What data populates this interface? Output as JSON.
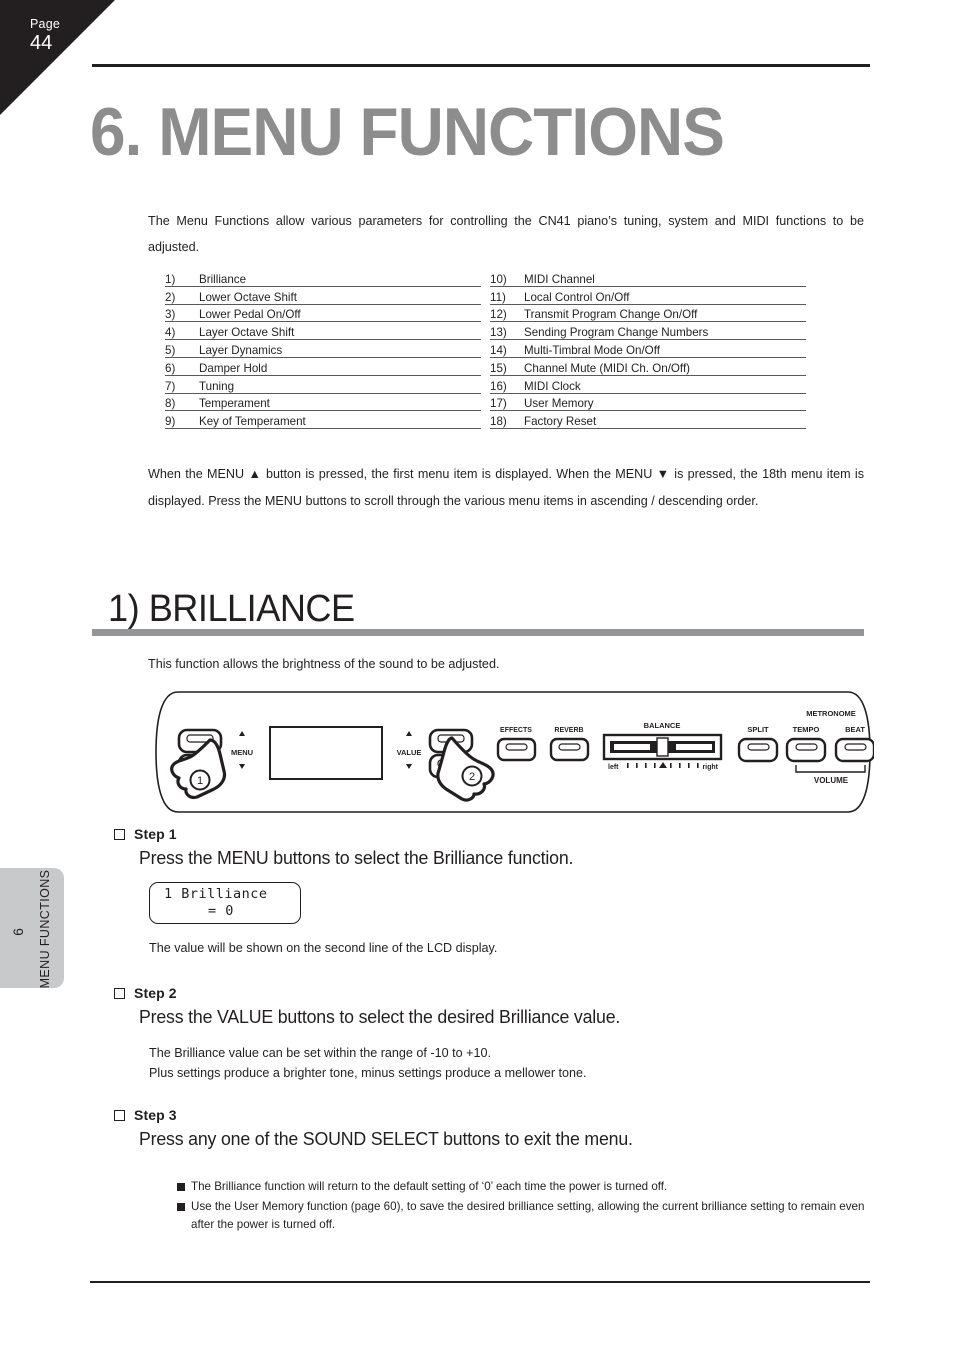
{
  "page": {
    "corner_label": "Page",
    "corner_number": "44",
    "chapter_title": "6. MENU FUNCTIONS",
    "intro": "The Menu Functions allow various parameters for controlling the CN41 piano’s tuning, system and MIDI functions to be adjusted.",
    "nav_paragraph": "When the MENU ▲ button is pressed, the first menu item is displayed.  When the MENU ▼ is pressed, the 18th menu item is displayed.  Press the MENU buttons to scroll through the various menu items in ascending / descending order."
  },
  "function_list": {
    "left": [
      {
        "num": "1)",
        "label": "Brilliance"
      },
      {
        "num": "2)",
        "label": "Lower Octave Shift"
      },
      {
        "num": "3)",
        "label": "Lower Pedal On/Off"
      },
      {
        "num": "4)",
        "label": "Layer Octave Shift"
      },
      {
        "num": "5)",
        "label": "Layer Dynamics"
      },
      {
        "num": "6)",
        "label": "Damper Hold"
      },
      {
        "num": "7)",
        "label": "Tuning"
      },
      {
        "num": "8)",
        "label": "Temperament"
      },
      {
        "num": "9)",
        "label": "Key of Temperament"
      }
    ],
    "right": [
      {
        "num": "10)",
        "label": "MIDI Channel"
      },
      {
        "num": "11)",
        "label": "Local Control On/Off"
      },
      {
        "num": "12)",
        "label": "Transmit Program Change On/Off"
      },
      {
        "num": "13)",
        "label": "Sending Program Change Numbers"
      },
      {
        "num": "14)",
        "label": "Multi-Timbral Mode On/Off"
      },
      {
        "num": "15)",
        "label": "Channel Mute (MIDI Ch. On/Off)"
      },
      {
        "num": "16)",
        "label": "MIDI Clock"
      },
      {
        "num": "17)",
        "label": "User Memory"
      },
      {
        "num": "18)",
        "label": "Factory Reset"
      }
    ]
  },
  "section": {
    "heading": "1) BRILLIANCE",
    "description": "This function allows the brightness of the sound to be adjusted."
  },
  "panel": {
    "menu_label": "MENU",
    "value_label": "VALUE",
    "effects_label": "EFFECTS",
    "reverb_label": "REVERB",
    "balance_label": "BALANCE",
    "balance_left": "left",
    "balance_right": "right",
    "split_label": "SPLIT",
    "metronome_label": "METRONOME",
    "tempo_label": "TEMPO",
    "beat_label": "BEAT",
    "volume_label": "VOLUME",
    "callout_1": "1",
    "callout_2": "2",
    "up_arrow": "▲",
    "down_arrow": "▼"
  },
  "steps": [
    {
      "title": "Step 1",
      "instruction": "Press the MENU buttons to select the Brilliance function.",
      "lcd_line1": "1 Brilliance",
      "lcd_line2": "=   0",
      "sub": "The value will be shown on the second line of the LCD display."
    },
    {
      "title": "Step 2",
      "instruction": "Press the VALUE buttons to select the desired Brilliance value.",
      "sub1": "The Brilliance value can be set within the range of -10 to +10.",
      "sub2": "Plus settings produce a brighter tone, minus settings produce a mellower tone."
    },
    {
      "title": "Step 3",
      "instruction": "Press any one of the SOUND SELECT buttons to exit the menu."
    }
  ],
  "notes": [
    "The Brilliance function will return to the default setting of ‘0’ each time the power is turned off.",
    "Use the User Memory function (page 60), to save the desired brilliance setting, allowing the current brilliance setting to remain even after the power is turned off."
  ],
  "side_tab": {
    "number": "6",
    "label": "MENU FUNCTIONS"
  },
  "colors": {
    "title_gray": "#8d8d8d",
    "section_bar": "#939598",
    "ink": "#231f20",
    "tab_gray": "#c8c9ca"
  }
}
